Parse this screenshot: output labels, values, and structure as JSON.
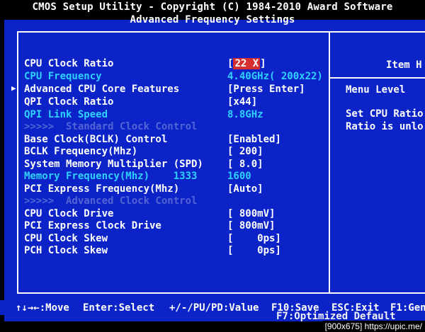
{
  "header": {
    "line1": "CMOS Setup Utility - Copyright (C) 1984-2010 Award Software",
    "line2": "Advanced Frequency Settings"
  },
  "settings": [
    {
      "label": "CPU Clock Ratio",
      "value": "22 X",
      "selected": true,
      "style": "white"
    },
    {
      "label": "CPU Frequency",
      "value": "4.40GHz( 200x22)",
      "style": "cyan"
    },
    {
      "label": "Advanced CPU Core Features",
      "value": "[Press Enter]",
      "style": "white",
      "submenu": true
    },
    {
      "label": "QPI Clock Ratio",
      "value": "[x44]",
      "style": "white"
    },
    {
      "label": "QPI Link Speed",
      "value": "8.8GHz",
      "style": "cyan"
    },
    {
      "label": ">>>>>  Standard Clock Control",
      "value": "",
      "style": "dim"
    },
    {
      "label": "Base Clock(BCLK) Control",
      "value": "[Enabled]",
      "style": "white"
    },
    {
      "label": "BCLK Frequency(Mhz)",
      "value": "[ 200]",
      "style": "white"
    },
    {
      "label": "System Memory Multiplier (SPD)",
      "value": "[ 8.0]",
      "style": "white"
    },
    {
      "label": "Memory Frequency(Mhz)    1333",
      "value": "1600",
      "style": "cyan"
    },
    {
      "label": "PCI Express Frequency(Mhz)",
      "value": "[Auto]",
      "style": "white"
    },
    {
      "label": ">>>>>  Advanced Clock Control",
      "value": "",
      "style": "dim"
    },
    {
      "label": "CPU Clock Drive",
      "value": "[ 800mV]",
      "style": "white"
    },
    {
      "label": "PCI Express Clock Drive",
      "value": "[ 800mV]",
      "style": "white"
    },
    {
      "label": "CPU Clock Skew",
      "value": "[    0ps]",
      "style": "white"
    },
    {
      "label": "PCH Clock Skew",
      "value": "[    0ps]",
      "style": "white"
    }
  ],
  "help": {
    "title": "Item H",
    "menu_level": "Menu Level",
    "description_1": "Set CPU Ratio",
    "description_2": "Ratio is unlo"
  },
  "footer": {
    "move": "↑↓→←:Move",
    "select": "Enter:Select",
    "value": "+/-/PU/PD:Value",
    "save": "F10:Save",
    "exit": "ESC:Exit",
    "general": "F1:Gen",
    "optimized": "F7:Optimized Default"
  },
  "watermark": "[900x675] https://upic.me/"
}
